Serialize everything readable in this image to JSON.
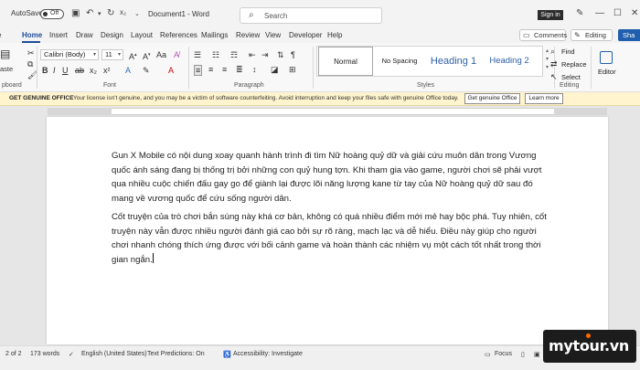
{
  "titlebar": {
    "autosave_label": "AutoSave",
    "autosave_state": "Off",
    "doc_title": "Document1 - Word",
    "search_placeholder": "Search",
    "signin_label": "Sign in"
  },
  "tabs": [
    "Home",
    "Insert",
    "Draw",
    "Design",
    "Layout",
    "References",
    "Mailings",
    "Review",
    "View",
    "Developer",
    "Help"
  ],
  "header_buttons": {
    "comments": "Comments",
    "editing": "Editing",
    "share": "Sha"
  },
  "ribbon": {
    "paste_label": "aste",
    "font_name": "Calibri (Body)",
    "font_size": "11",
    "groups": {
      "clipboard": "pboard",
      "font": "Font",
      "paragraph": "Paragraph",
      "styles": "Styles",
      "editing": "Editing"
    },
    "styles": [
      "Normal",
      "No Spacing",
      "Heading 1",
      "Heading 2"
    ],
    "editing": {
      "find": "Find",
      "replace": "Replace",
      "select": "Select"
    },
    "editor_label": "Editor"
  },
  "notice": {
    "title": "GET GENUINE OFFICE",
    "message": "Your license isn't genuine, and you may be a victim of software counterfeiting. Avoid interruption and keep your files safe with genuine Office today.",
    "get_button": "Get genuine Office",
    "learn_button": "Learn more"
  },
  "document": {
    "paragraph1": "Gun X Mobile có nội dung xoay quanh hành trình đi tìm Nữ hoàng quỷ dữ và giải cứu muôn dân trong Vương quốc ánh sáng đang bị thống trị bởi những con quỷ hung tợn. Khi tham gia vào game, người chơi sẽ phải vượt qua nhiều cuộc chiến đấu gay go để giành lại được lõi năng lượng kane từ tay của Nữ hoàng quỷ dữ sau đó mang về vương quốc để cứu sống người dân.",
    "paragraph2": "Cốt truyện của trò chơi bắn súng này khá cơ bản, không có quá nhiều điểm mới mẻ hay bộc phá. Tuy nhiên, cốt truyện này vẫn được nhiều người đánh giá cao bởi sự rõ ràng, mạch lạc và dễ hiểu. Điều này giúp cho người chơi nhanh chóng thích ứng được với bối cảnh game và hoàn thành các nhiệm vụ một cách tốt nhất trong thời gian ngắn."
  },
  "statusbar": {
    "page": "2 of 2",
    "words": "173 words",
    "language": "English (United States)",
    "text_predictions": "Text Predictions: On",
    "accessibility": "Accessibility: Investigate",
    "focus": "Focus"
  },
  "watermark": "mytour.vn"
}
